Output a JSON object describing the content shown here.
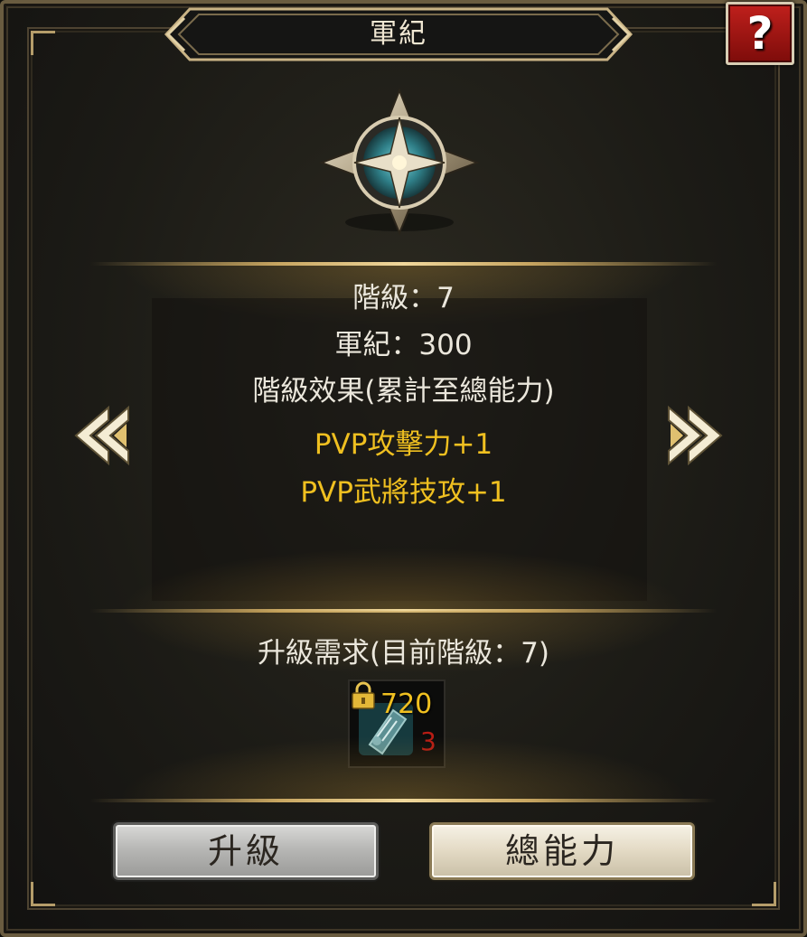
{
  "window": {
    "title": "軍紀",
    "help_label": "?"
  },
  "rank_info": {
    "rank_line": "階級：7",
    "discipline_line": "軍紀：300",
    "effects_heading": "階級效果(累計至總能力)",
    "effects": [
      "PVP攻擊力+1",
      "PVP武將技攻+1"
    ]
  },
  "requirement": {
    "heading": "升級需求(目前階級：7)",
    "item": {
      "icon": "scroll-item-icon",
      "locked": true,
      "required_count": "720",
      "owned_count": "3"
    }
  },
  "buttons": {
    "upgrade_label": "升級",
    "total_stats_label": "總能力"
  },
  "colors": {
    "effect_text": "#f0c020",
    "insufficient": "#b81c14",
    "help_button": "#c0201c"
  }
}
